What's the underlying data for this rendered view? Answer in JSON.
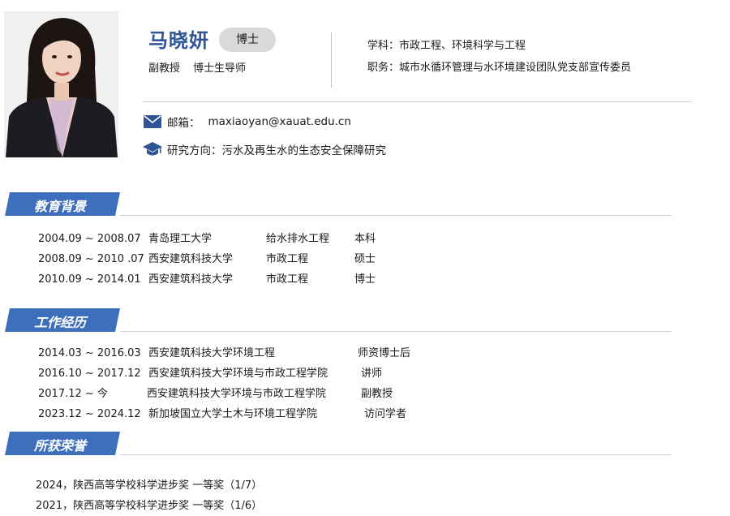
{
  "profile": {
    "name": "马晓妍",
    "degree_badge": "博士",
    "title": "副教授",
    "supervisor": "博士生导师",
    "discipline_label": "学科：",
    "discipline": "市政工程、环境科学与工程",
    "position_label": "职务：",
    "position": "城市水循环管理与水环境建设团队党支部宣传委员",
    "email_label": "邮箱：",
    "email": "maxiaoyan@xauat.edu.cn",
    "research_label": "研究方向：",
    "research": "污水及再生水的生态安全保障研究"
  },
  "icons": {
    "email": "envelope-icon",
    "research": "graduation-cap-icon"
  },
  "colors": {
    "accent": "#3e6fbd",
    "name": "#2f5597",
    "badge_bg": "#d9d9d9"
  },
  "education": {
    "heading": "教育背景",
    "rows": [
      {
        "period": "2004.09 ~ 2008.07",
        "school": "青岛理工大学",
        "major": "给水排水工程",
        "degree": "本科"
      },
      {
        "period": "2008.09 ~ 2010 .07",
        "school": "西安建筑科技大学",
        "major": "市政工程",
        "degree": "硕士"
      },
      {
        "period": "2010.09 ~ 2014.01",
        "school": "西安建筑科技大学",
        "major": "市政工程",
        "degree": "博士"
      }
    ]
  },
  "work": {
    "heading": "工作经历",
    "rows": [
      {
        "period": "2014.03 ~ 2016.03",
        "org": "西安建筑科技大学环境工程",
        "role": "师资博士后"
      },
      {
        "period": "2016.10 ~ 2017.12",
        "org": "西安建筑科技大学环境与市政工程学院",
        "role": "讲师"
      },
      {
        "period": "2017.12 ~ 今",
        "org": "西安建筑科技大学环境与市政工程学院",
        "role": "副教授"
      },
      {
        "period": "2023.12 ~ 2024.12",
        "org": "新加坡国立大学土木与环境工程学院",
        "role": "访问学者"
      }
    ]
  },
  "honors": {
    "heading": "所获荣誉",
    "items": [
      "2024，陕西高等学校科学进步奖 一等奖（1/7）",
      "2021，陕西高等学校科学进步奖 一等奖（1/6）"
    ]
  }
}
